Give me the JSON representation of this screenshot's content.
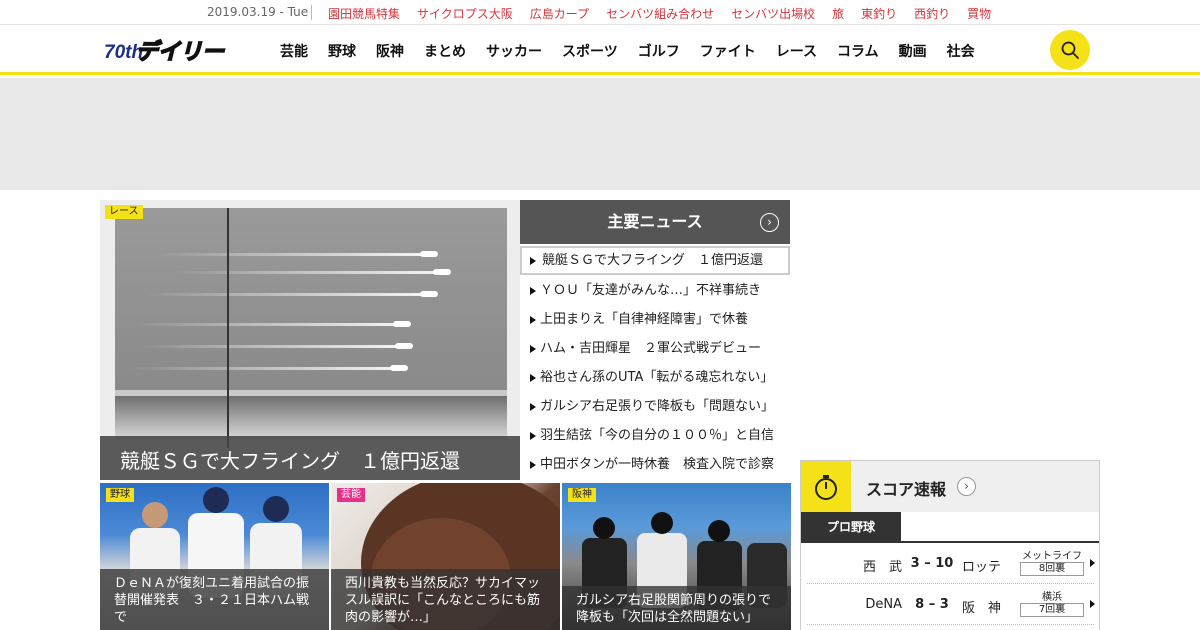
{
  "topbar": {
    "date": "2019.03.19 - Tue",
    "links": [
      "園田競馬特集",
      "サイクロプス大阪",
      "広島カープ",
      "センバツ組み合わせ",
      "センバツ出場校",
      "旅",
      "東釣り",
      "西釣り",
      "買物"
    ]
  },
  "header": {
    "logo_alt": "デイリー",
    "logo_badge": "70th",
    "nav": [
      "芸能",
      "野球",
      "阪神",
      "まとめ",
      "サッカー",
      "スポーツ",
      "ゴルフ",
      "ファイト",
      "レース",
      "コラム",
      "動画",
      "社会"
    ]
  },
  "main_story": {
    "tag": "レース",
    "headline": "競艇ＳＧで大フライング　１億円返還"
  },
  "major_news": {
    "title": "主要ニュース",
    "more": "›",
    "items": [
      "競艇ＳＧで大フライング　１億円返還",
      "ＹＯＵ「友達がみんな…」不祥事続き",
      "上田まりえ「自律神経障害」で休養",
      "ハム・吉田輝星　２軍公式戦デビュー",
      "裕也さん孫のUTA「転がる魂忘れない」",
      "ガルシア右足張りで降板も「問題ない」",
      "羽生結弦「今の自分の１００％」と自信",
      "中田ボタンが一時休養　検査入院で診察"
    ]
  },
  "thumbs": [
    {
      "tag": "野球",
      "caption": "ＤｅＮＡが復刻ユニ着用試合の振替開催発表　３・２１日本ハム戦で"
    },
    {
      "tag": "芸能",
      "caption": "西川貴教も当然反応？サカイマッスル誤訳に「こんなところにも筋肉の影響が…」"
    },
    {
      "tag": "阪神",
      "caption": "ガルシア右足股関節周りの張りで降板も「次回は全然問題ない」"
    }
  ],
  "score": {
    "title": "スコア速報",
    "more": "›",
    "tab": "プロ野球",
    "games": [
      {
        "home": "西　武",
        "result": "3 – 10",
        "away": "ロッテ",
        "stadium": "メットライフ",
        "inning": "8回裏"
      },
      {
        "home": "DeNA",
        "result": "8 – 3",
        "away": "阪　神",
        "stadium": "横浜",
        "inning": "7回裏"
      }
    ]
  },
  "colors": {
    "accent": "#f5e117",
    "link_red": "#d3363c",
    "header_gray": "#555555",
    "tag_pink": "#e8308a"
  }
}
